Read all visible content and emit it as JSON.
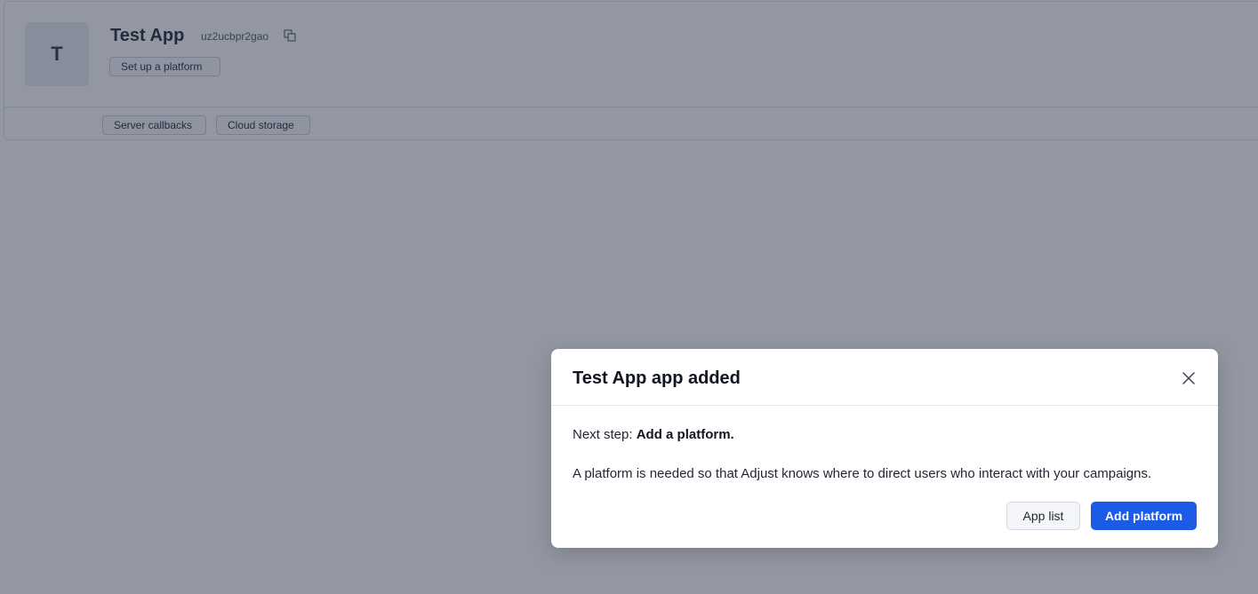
{
  "app": {
    "avatar_letter": "T",
    "name": "Test App",
    "token": "uz2ucbpr2gao",
    "setup_button": "Set up a platform",
    "tabs": [
      "Server callbacks",
      "Cloud storage"
    ]
  },
  "modal": {
    "title": "Test App app added",
    "next_step_prefix": "Next step:",
    "next_step_bold": "Add a platform.",
    "description": "A platform is needed so that Adjust knows where to direct users who interact with your campaigns.",
    "secondary_button": "App list",
    "primary_button": "Add platform"
  },
  "icons": {
    "copy": "copy-icon",
    "close": "close-icon"
  },
  "colors": {
    "primary": "#1b5be6",
    "overlay": "rgba(40, 47, 70, 0.5)"
  }
}
